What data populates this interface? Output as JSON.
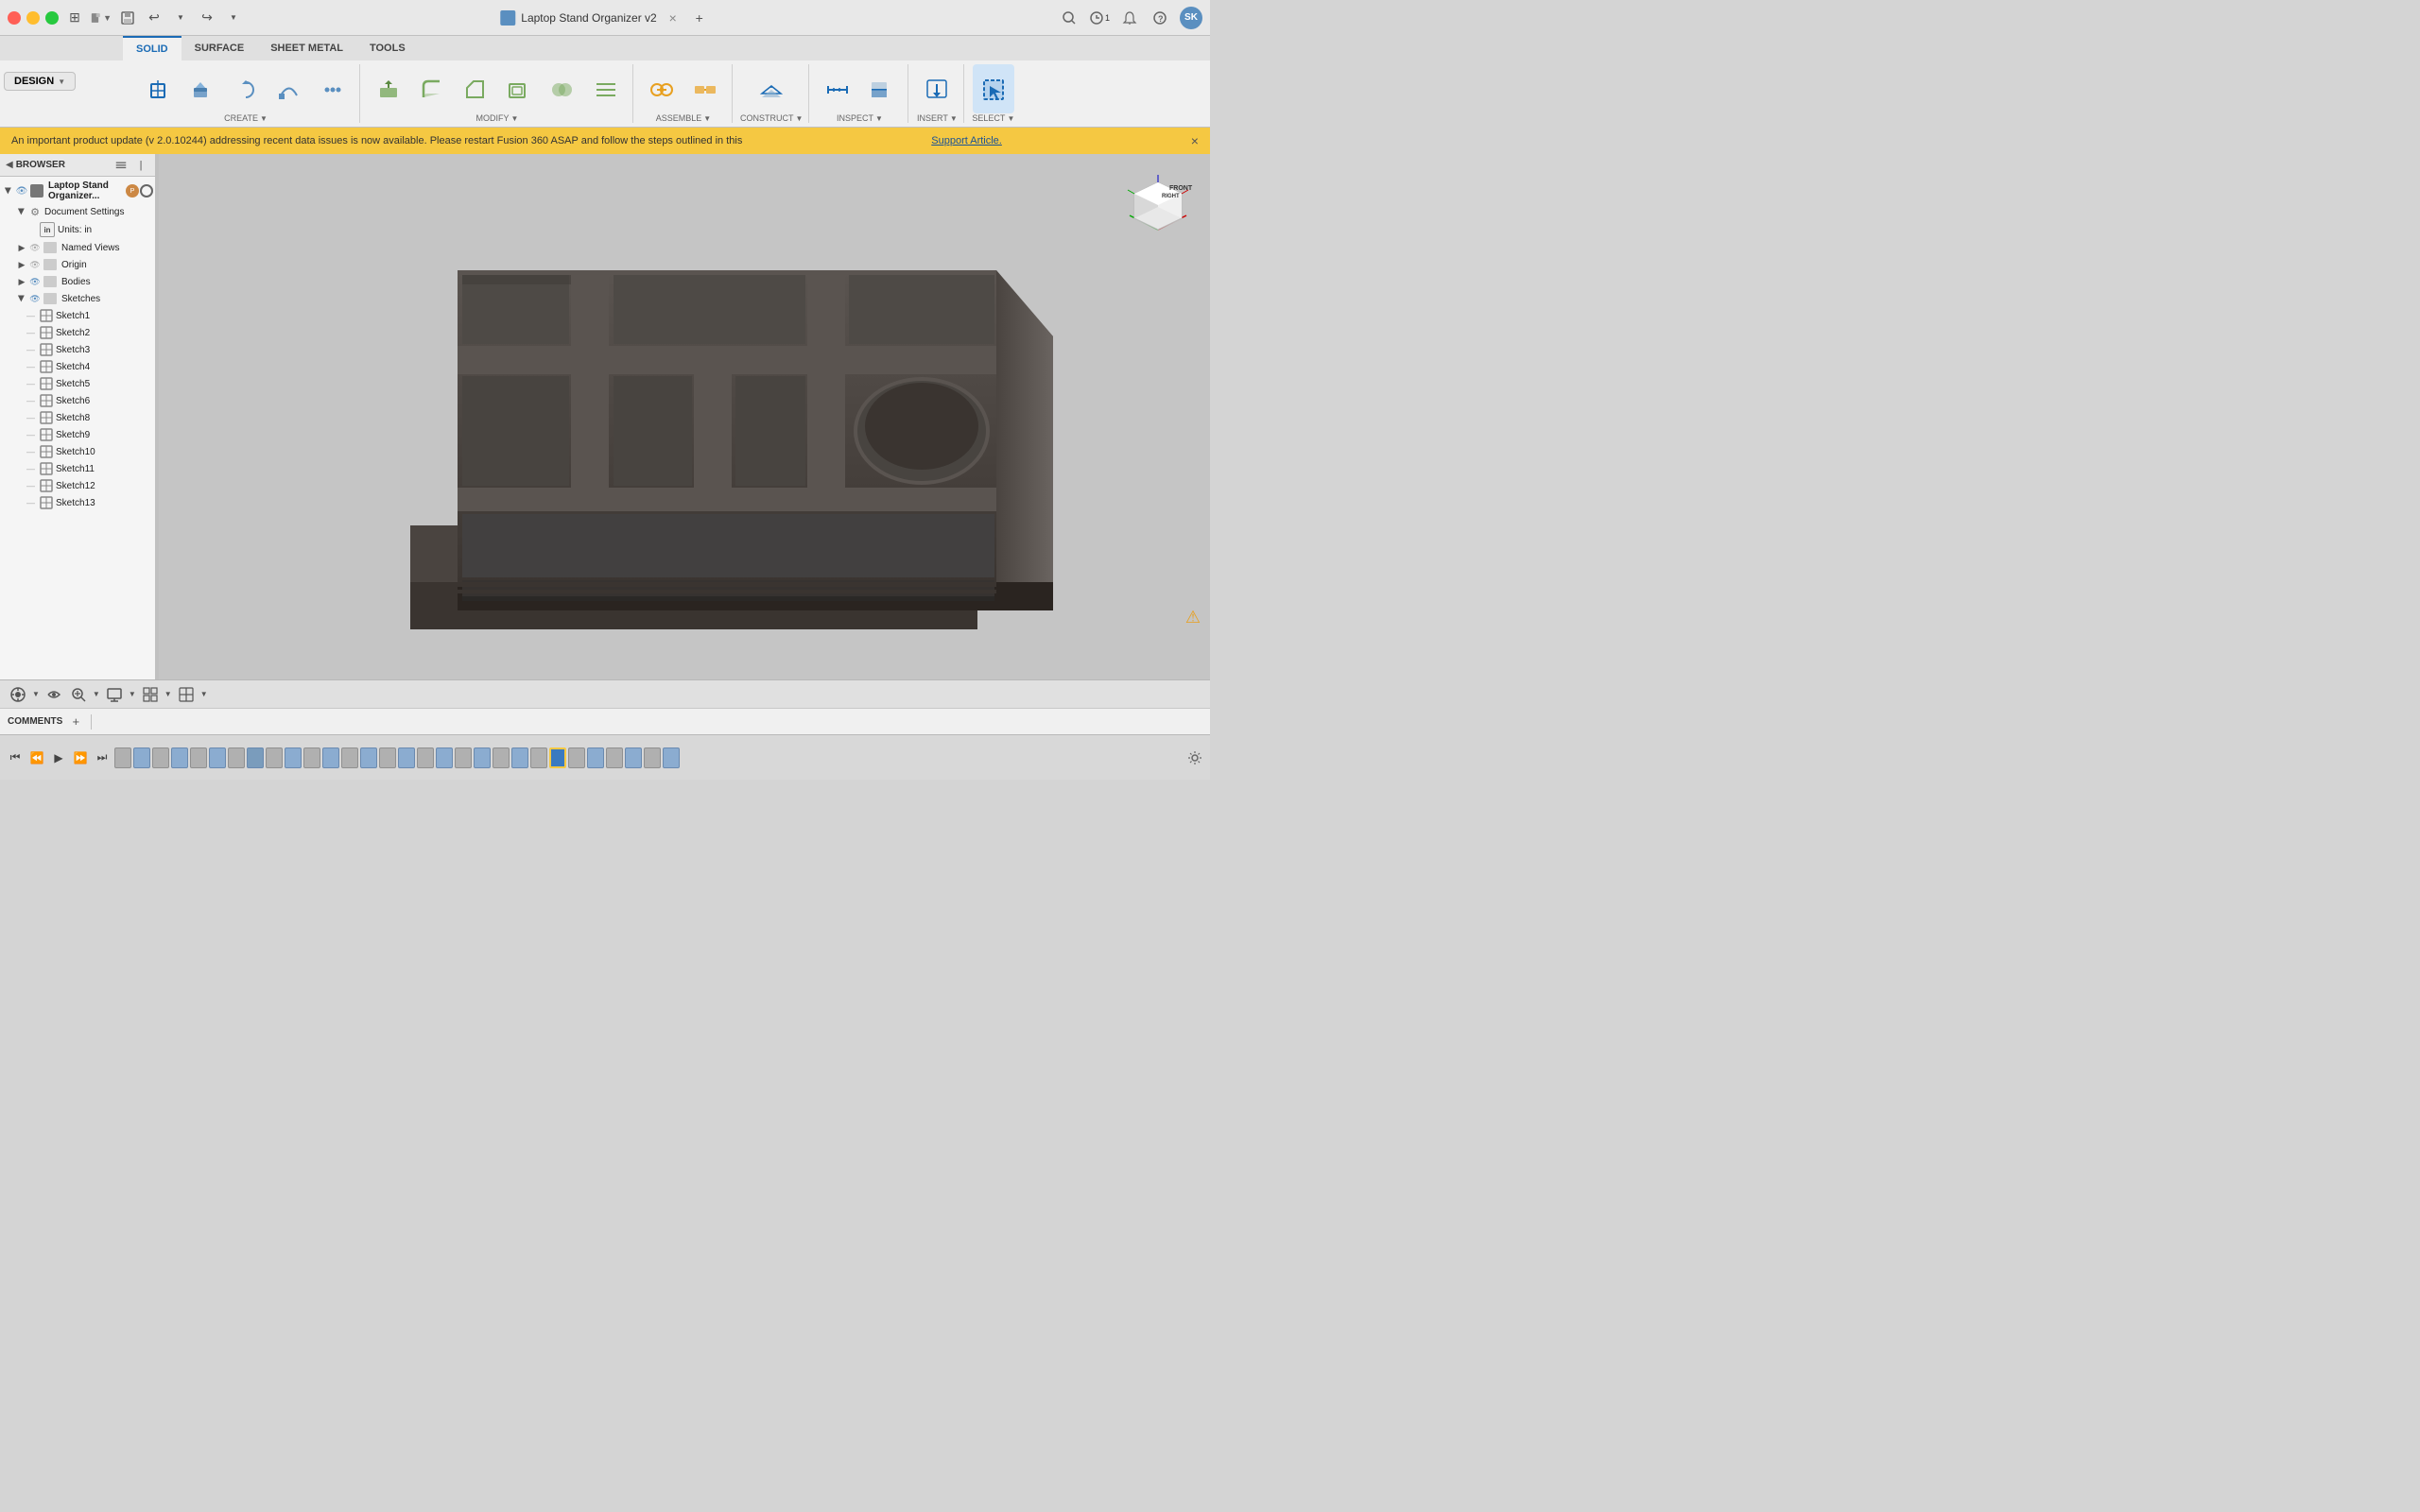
{
  "titlebar": {
    "title": "Laptop Stand Organizer v2",
    "close_label": "×",
    "new_tab_label": "+"
  },
  "appbar": {
    "grid_icon": "⊞",
    "file_icon": "📄",
    "save_icon": "💾",
    "undo_icon": "↩",
    "redo_icon": "↪"
  },
  "ribbon": {
    "tabs": [
      "SOLID",
      "SURFACE",
      "SHEET METAL",
      "TOOLS"
    ],
    "active_tab": "SOLID",
    "design_label": "DESIGN",
    "groups": [
      {
        "label": "CREATE",
        "items": [
          {
            "icon": "create1",
            "label": ""
          },
          {
            "icon": "create2",
            "label": ""
          },
          {
            "icon": "create3",
            "label": ""
          },
          {
            "icon": "create4",
            "label": ""
          },
          {
            "icon": "create5",
            "label": ""
          }
        ]
      },
      {
        "label": "MODIFY",
        "items": [
          {
            "icon": "mod1",
            "label": ""
          },
          {
            "icon": "mod2",
            "label": ""
          },
          {
            "icon": "mod3",
            "label": ""
          },
          {
            "icon": "mod4",
            "label": ""
          },
          {
            "icon": "mod5",
            "label": ""
          }
        ]
      },
      {
        "label": "ASSEMBLE",
        "items": [
          {
            "icon": "asm1",
            "label": ""
          },
          {
            "icon": "asm2",
            "label": ""
          }
        ]
      },
      {
        "label": "CONSTRUCT",
        "items": [
          {
            "icon": "con1",
            "label": ""
          }
        ]
      },
      {
        "label": "INSPECT",
        "items": [
          {
            "icon": "ins1",
            "label": ""
          },
          {
            "icon": "ins2",
            "label": ""
          }
        ]
      },
      {
        "label": "INSERT",
        "items": [
          {
            "icon": "ins3",
            "label": ""
          }
        ]
      },
      {
        "label": "SELECT",
        "items": [
          {
            "icon": "sel1",
            "label": ""
          }
        ]
      }
    ]
  },
  "notification": {
    "text": "An important product update (v 2.0.10244) addressing recent data issues is now available. Please restart Fusion 360 ASAP and follow the steps outlined in this ",
    "link_text": "Support Article.",
    "close_icon": "×"
  },
  "browser": {
    "title": "BROWSER",
    "root_label": "Laptop Stand Organizer...",
    "document_settings_label": "Document Settings",
    "units_label": "Units: in",
    "named_views_label": "Named Views",
    "origin_label": "Origin",
    "bodies_label": "Bodies",
    "sketches_label": "Sketches",
    "sketches": [
      "Sketch1",
      "Sketch2",
      "Sketch3",
      "Sketch4",
      "Sketch5",
      "Sketch6",
      "Sketch8",
      "Sketch9",
      "Sketch10",
      "Sketch11",
      "Sketch12",
      "Sketch13"
    ]
  },
  "comments": {
    "label": "COMMENTS",
    "add_icon": "+"
  },
  "viewport": {
    "model_color": "#6b6560",
    "bg_color": "#c8c8c8"
  },
  "timeline": {
    "play_prev_label": "⏮",
    "play_back_label": "⏪",
    "play_label": "▶",
    "play_next_label": "⏭",
    "play_end_label": "⏭",
    "markers_count": 30
  },
  "statusbar": {
    "warning_icon": "⚠"
  }
}
